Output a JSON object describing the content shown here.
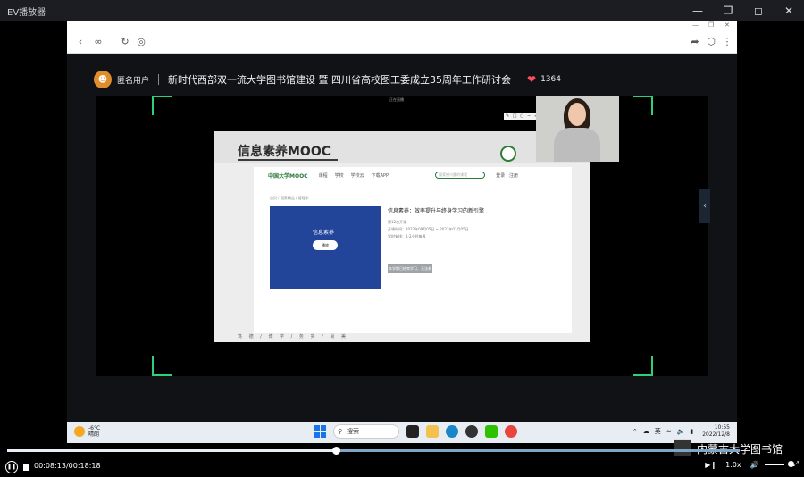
{
  "window": {
    "title": "EV播放器",
    "controls": [
      "minimize",
      "maximize",
      "restore",
      "close"
    ]
  },
  "live": {
    "user": "匿名用户",
    "title": "新时代西部双一流大学图书馆建设 暨 四川省高校图工委成立35周年工作研讨会",
    "likes": "1364",
    "top_tag": "正在直播"
  },
  "slide": {
    "title": "信息素养MOOC",
    "mooc": {
      "brand": "中国大学MOOC",
      "nav": [
        "课程",
        "学校",
        "学校云",
        "下载APP"
      ],
      "search_placeholder": "搜索感兴趣的课程",
      "auth": "登录 | 注册",
      "crumb": "首页 / 国家精品 / 管理学",
      "card_name": "信息素养",
      "play_label": "播放",
      "course_title": "信息素养：效率提升与终身学习的新引擎",
      "meta": [
        "第12次开课",
        "开课时间：2022年09月05日 ~ 2023年01月05日",
        "学时安排：1-2小时每周"
      ],
      "enroll_label": "本学期已结束学习，无法参加"
    },
    "footer": "笃 德 / 博 学 / 务 实 / 尚 美"
  },
  "taskbar": {
    "temp": "-6°C",
    "weather": "晴朗",
    "search_label": "搜索",
    "lang": "英",
    "time": "10:55",
    "date": "2022/12/8"
  },
  "player": {
    "elapsed": "00:08:13",
    "total": "00:18:18",
    "progress": 0.449,
    "speed": "1.0x",
    "volume": 0.9
  },
  "library": "内蒙古大学图书馆"
}
